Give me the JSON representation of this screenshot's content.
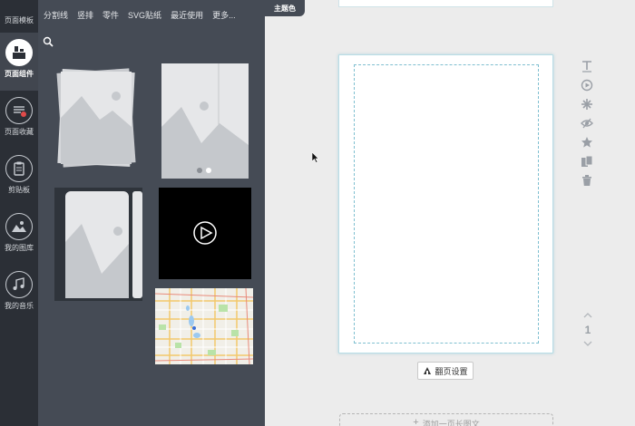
{
  "rail": {
    "top_label": "页面模板",
    "items": [
      {
        "label": "页面组件",
        "icon": "layout-components-icon",
        "active": true
      },
      {
        "label": "页面收藏",
        "icon": "favorites-list-icon",
        "active": false
      },
      {
        "label": "剪贴板",
        "icon": "clipboard-icon",
        "active": false
      },
      {
        "label": "我的图库",
        "icon": "image-gallery-icon",
        "active": false
      },
      {
        "label": "我的音乐",
        "icon": "music-note-icon",
        "active": false
      }
    ]
  },
  "panel": {
    "tabs": [
      "分割线",
      "竖排",
      "零件",
      "SVG贴纸",
      "最近使用",
      "更多..."
    ],
    "thumbnails": [
      "stacked-images-component",
      "image-carousel-component",
      "image-swiper-component",
      "video-player-component",
      "map-component"
    ]
  },
  "theme_tab": "主题色",
  "toolbar": {
    "tools": [
      "text-icon",
      "play-circle-icon",
      "sparkle-icon",
      "eye-slash-icon",
      "star-icon",
      "copy-page-icon",
      "trash-icon"
    ]
  },
  "pager": {
    "current": "1"
  },
  "flip_settings": "翻页设置",
  "add_page": "添加一页长图文",
  "colors": {
    "rail": "#2b2f36",
    "panel": "#454b55",
    "canvas": "#ececec",
    "page_border": "#b9dde6"
  }
}
